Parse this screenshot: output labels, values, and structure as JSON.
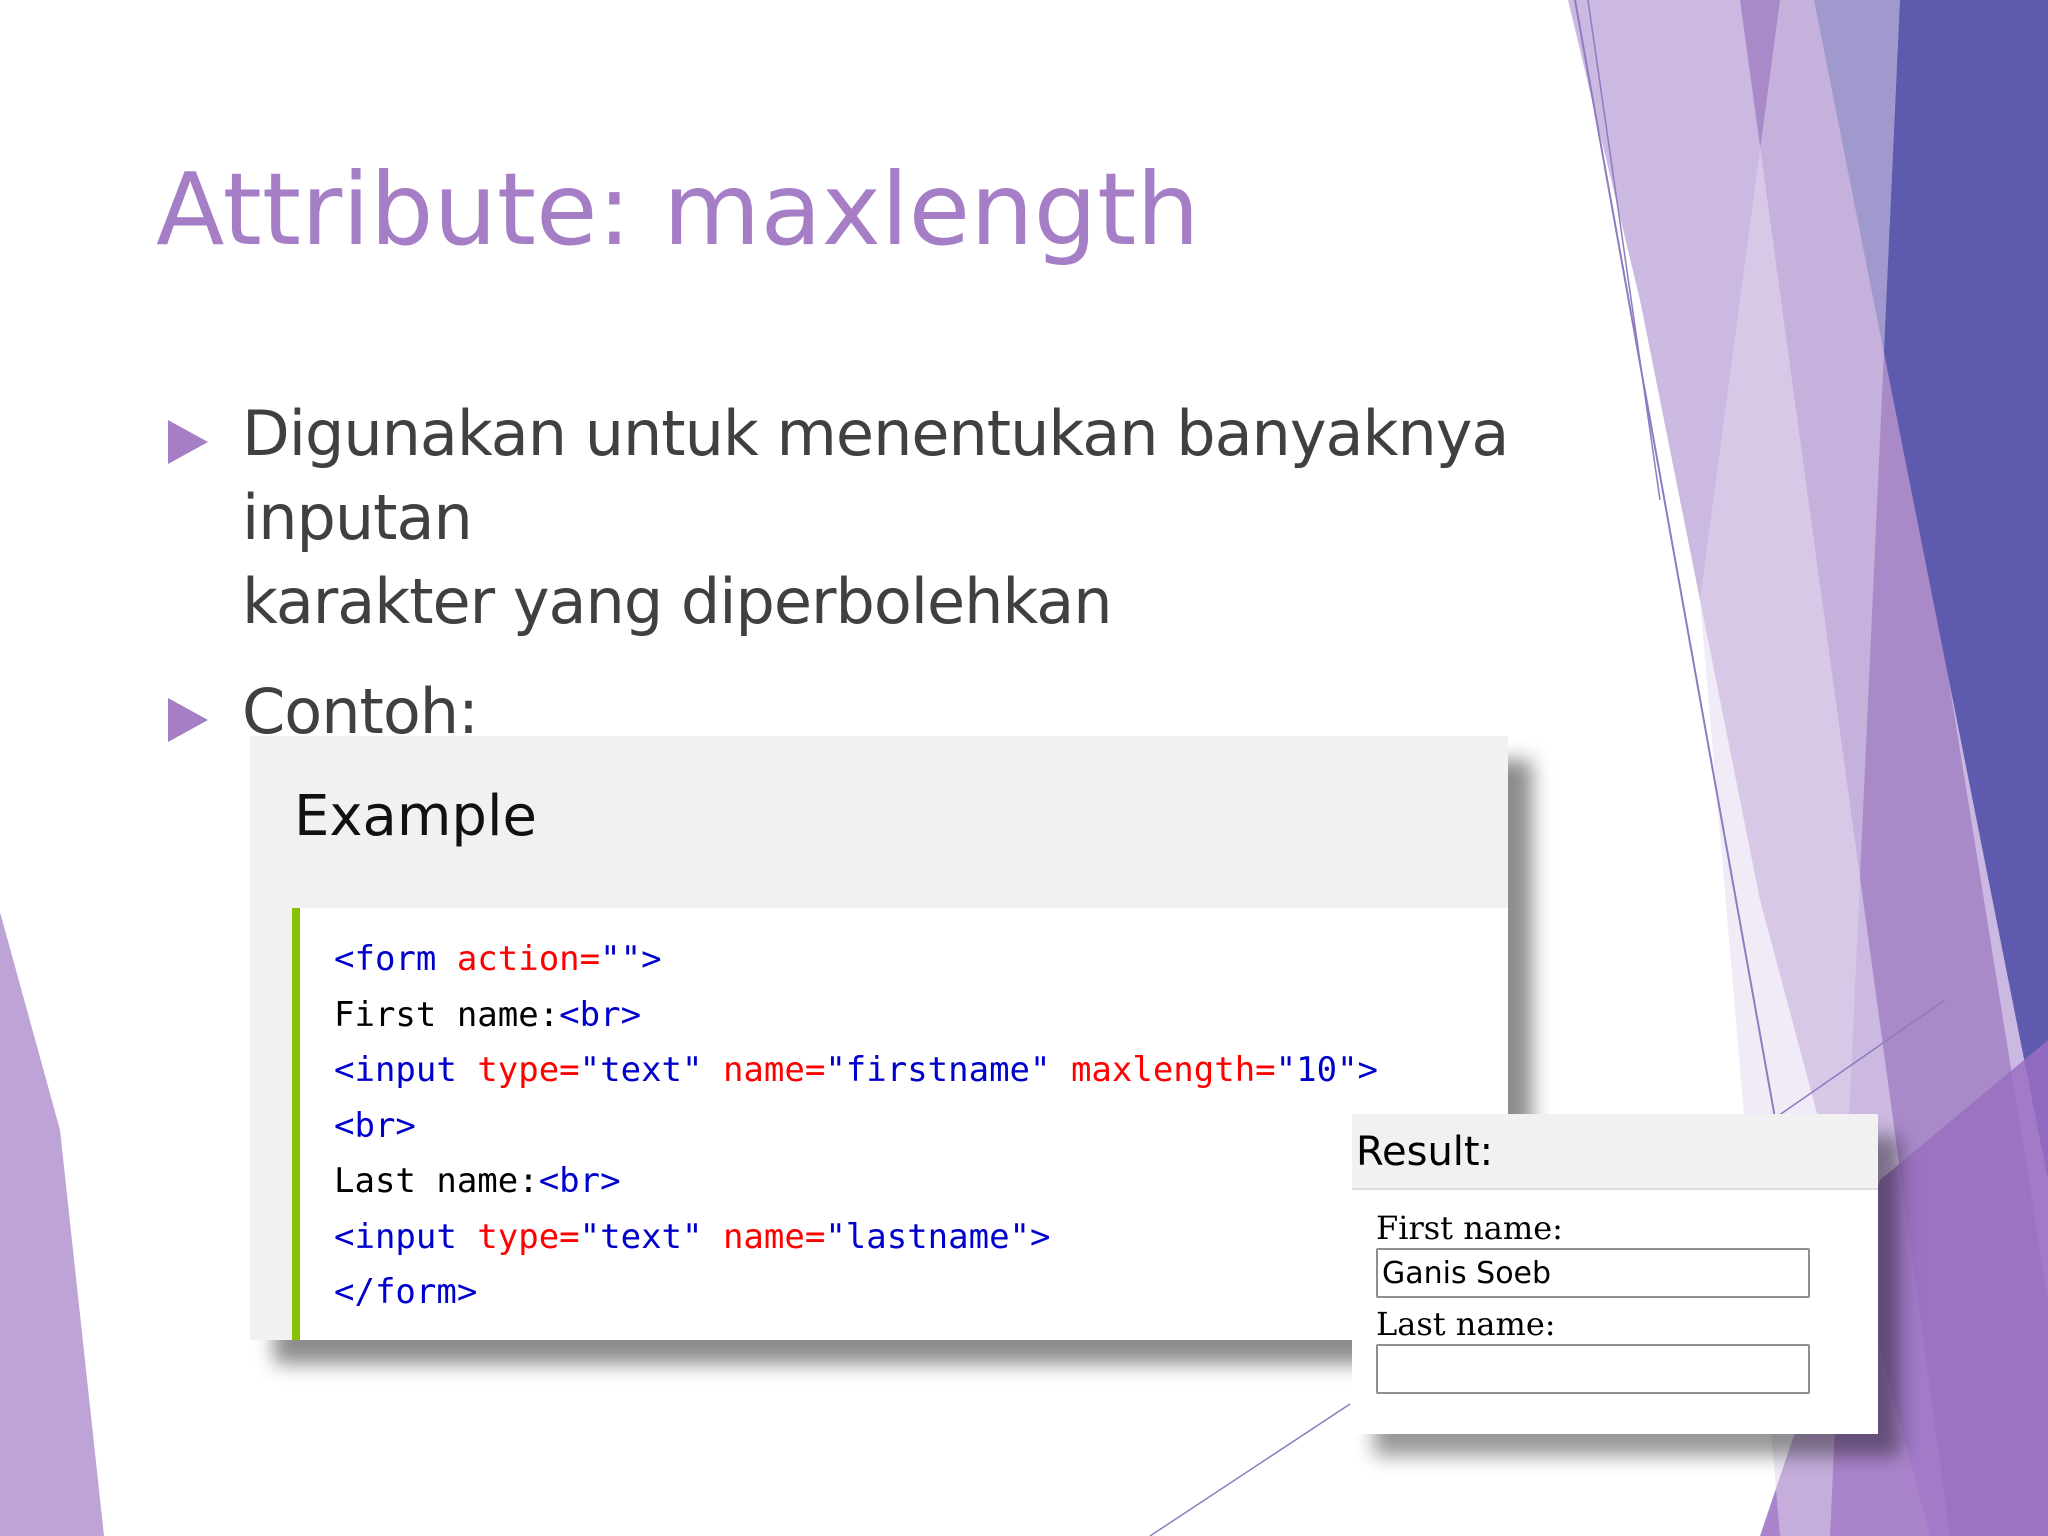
{
  "slide": {
    "title": "Attribute: maxlength",
    "bullets": [
      {
        "line1": "Digunakan untuk menentukan banyaknya inputan",
        "line2": "karakter yang diperbolehkan"
      },
      {
        "line1": "Contoh:"
      }
    ]
  },
  "example": {
    "heading": "Example",
    "code": {
      "l1_open": "<form",
      "l1_attr": " action=",
      "l1_val": "\"\">",
      "l2_text": "First name:",
      "l2_tag": "<br>",
      "l3_open": "<input",
      "l3_attr1": " type=",
      "l3_val1": "\"text\"",
      "l3_attr2": " name=",
      "l3_val2": "\"firstname\"",
      "l3_attr3": " maxlength=",
      "l3_val3": "\"10\">",
      "l4_tag": "<br>",
      "l5_text": "Last name:",
      "l5_tag": "<br>",
      "l6_open": "<input",
      "l6_attr1": " type=",
      "l6_val1": "\"text\"",
      "l6_attr2": " name=",
      "l6_val2": "\"lastname\">",
      "l7_tag": "</form>"
    }
  },
  "result": {
    "heading": "Result:",
    "first_name_label": "First name:",
    "first_name_value": "Ganis Soeb",
    "last_name_label": "Last name:",
    "last_name_value": ""
  },
  "colors": {
    "title": "#a57ec6",
    "bullet": "#a57ec6",
    "code_tag": "#0000cd",
    "code_attr": "#ff0000",
    "code_accent": "#8ac007",
    "deco_light_purple": "#b89cd3",
    "deco_dark_blue": "#5e5aad"
  }
}
